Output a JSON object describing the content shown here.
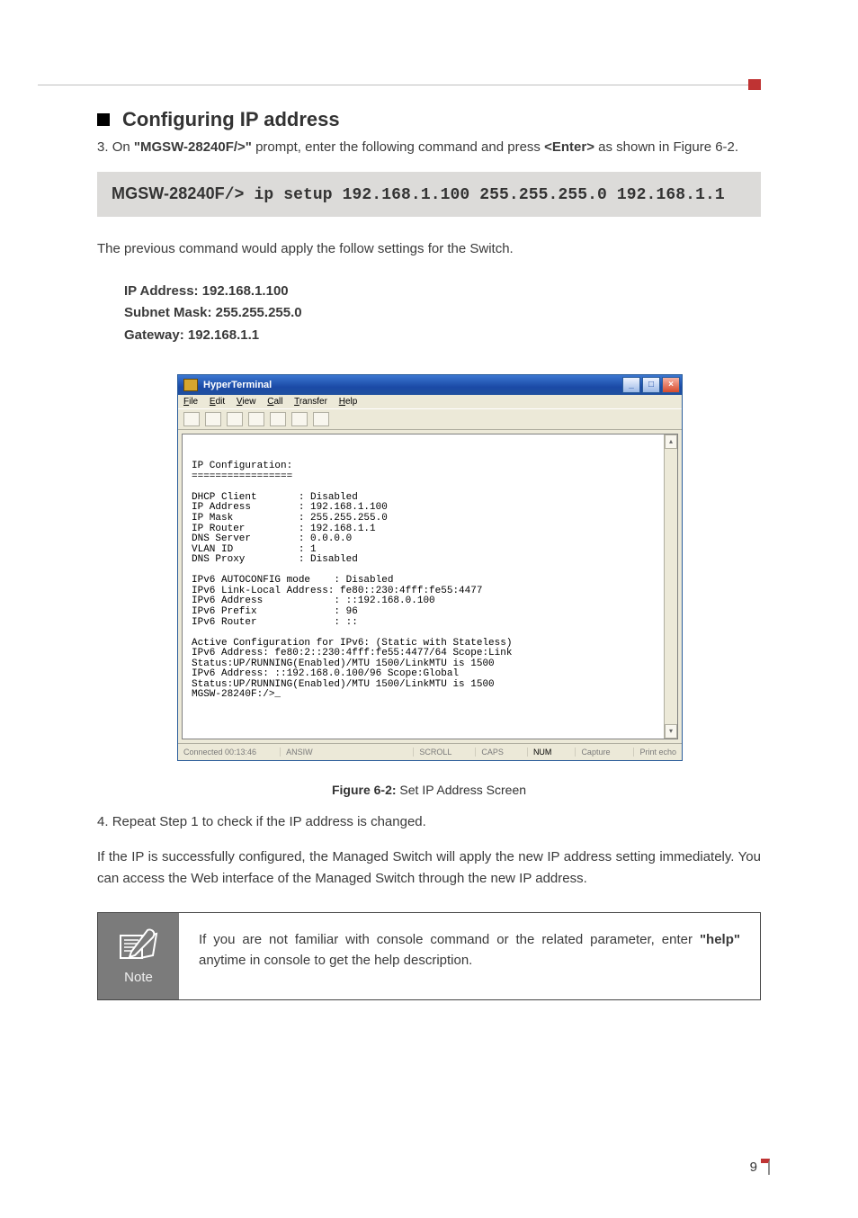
{
  "heading": "Configuring IP address",
  "step3": {
    "num": "3. ",
    "pre": "On ",
    "prompt": "\"MGSW-28240F/>\"",
    "mid": " prompt, enter the following command and press ",
    "enter": "<Enter>",
    "post": " as shown in Figure 6-2."
  },
  "cmd": {
    "prefix": "MGSW-28240F",
    "code": "/> ip setup 192.168.1.100 255.255.255.0 192.168.1.1"
  },
  "prev_cmd_text": "The previous command would apply the follow settings for the Switch.",
  "settings": {
    "ip": "IP Address: 192.168.1.100",
    "mask": "Subnet Mask: 255.255.255.0",
    "gw": "Gateway: 192.168.1.1"
  },
  "terminal": {
    "title": "HyperTerminal",
    "menus": {
      "file": "File",
      "edit": "Edit",
      "view": "View",
      "call": "Call",
      "transfer": "Transfer",
      "help": "Help"
    },
    "body": "\nIP Configuration:\n=================\n\nDHCP Client       : Disabled\nIP Address        : 192.168.1.100\nIP Mask           : 255.255.255.0\nIP Router         : 192.168.1.1\nDNS Server        : 0.0.0.0\nVLAN ID           : 1\nDNS Proxy         : Disabled\n\nIPv6 AUTOCONFIG mode    : Disabled\nIPv6 Link-Local Address: fe80::230:4fff:fe55:4477\nIPv6 Address            : ::192.168.0.100\nIPv6 Prefix             : 96\nIPv6 Router             : ::\n\nActive Configuration for IPv6: (Static with Stateless)\nIPv6 Address: fe80:2::230:4fff:fe55:4477/64 Scope:Link\nStatus:UP/RUNNING(Enabled)/MTU 1500/LinkMTU is 1500\nIPv6 Address: ::192.168.0.100/96 Scope:Global\nStatus:UP/RUNNING(Enabled)/MTU 1500/LinkMTU is 1500\nMGSW-28240F:/>_",
    "status": {
      "connected": "Connected 00:13:46",
      "emul": "ANSIW",
      "scroll": "SCROLL",
      "caps": "CAPS",
      "num": "NUM",
      "capture": "Capture",
      "printecho": "Print echo"
    }
  },
  "figure_caption": {
    "bold": "Figure 6-2:",
    "rest": "  Set IP Address Screen"
  },
  "step4": {
    "num": "4. ",
    "text": "Repeat Step 1 to check if the IP address is changed."
  },
  "para_success": "If the IP is successfully configured, the Managed Switch will apply the new IP address setting immediately. You can access the Web interface of the Managed Switch through the new IP address.",
  "note": {
    "label": "Note",
    "pre": "If you are not familiar with console command or the related parameter, enter ",
    "help": "\"help\"",
    "post": " anytime in console to get the help description."
  },
  "page_number": "9"
}
